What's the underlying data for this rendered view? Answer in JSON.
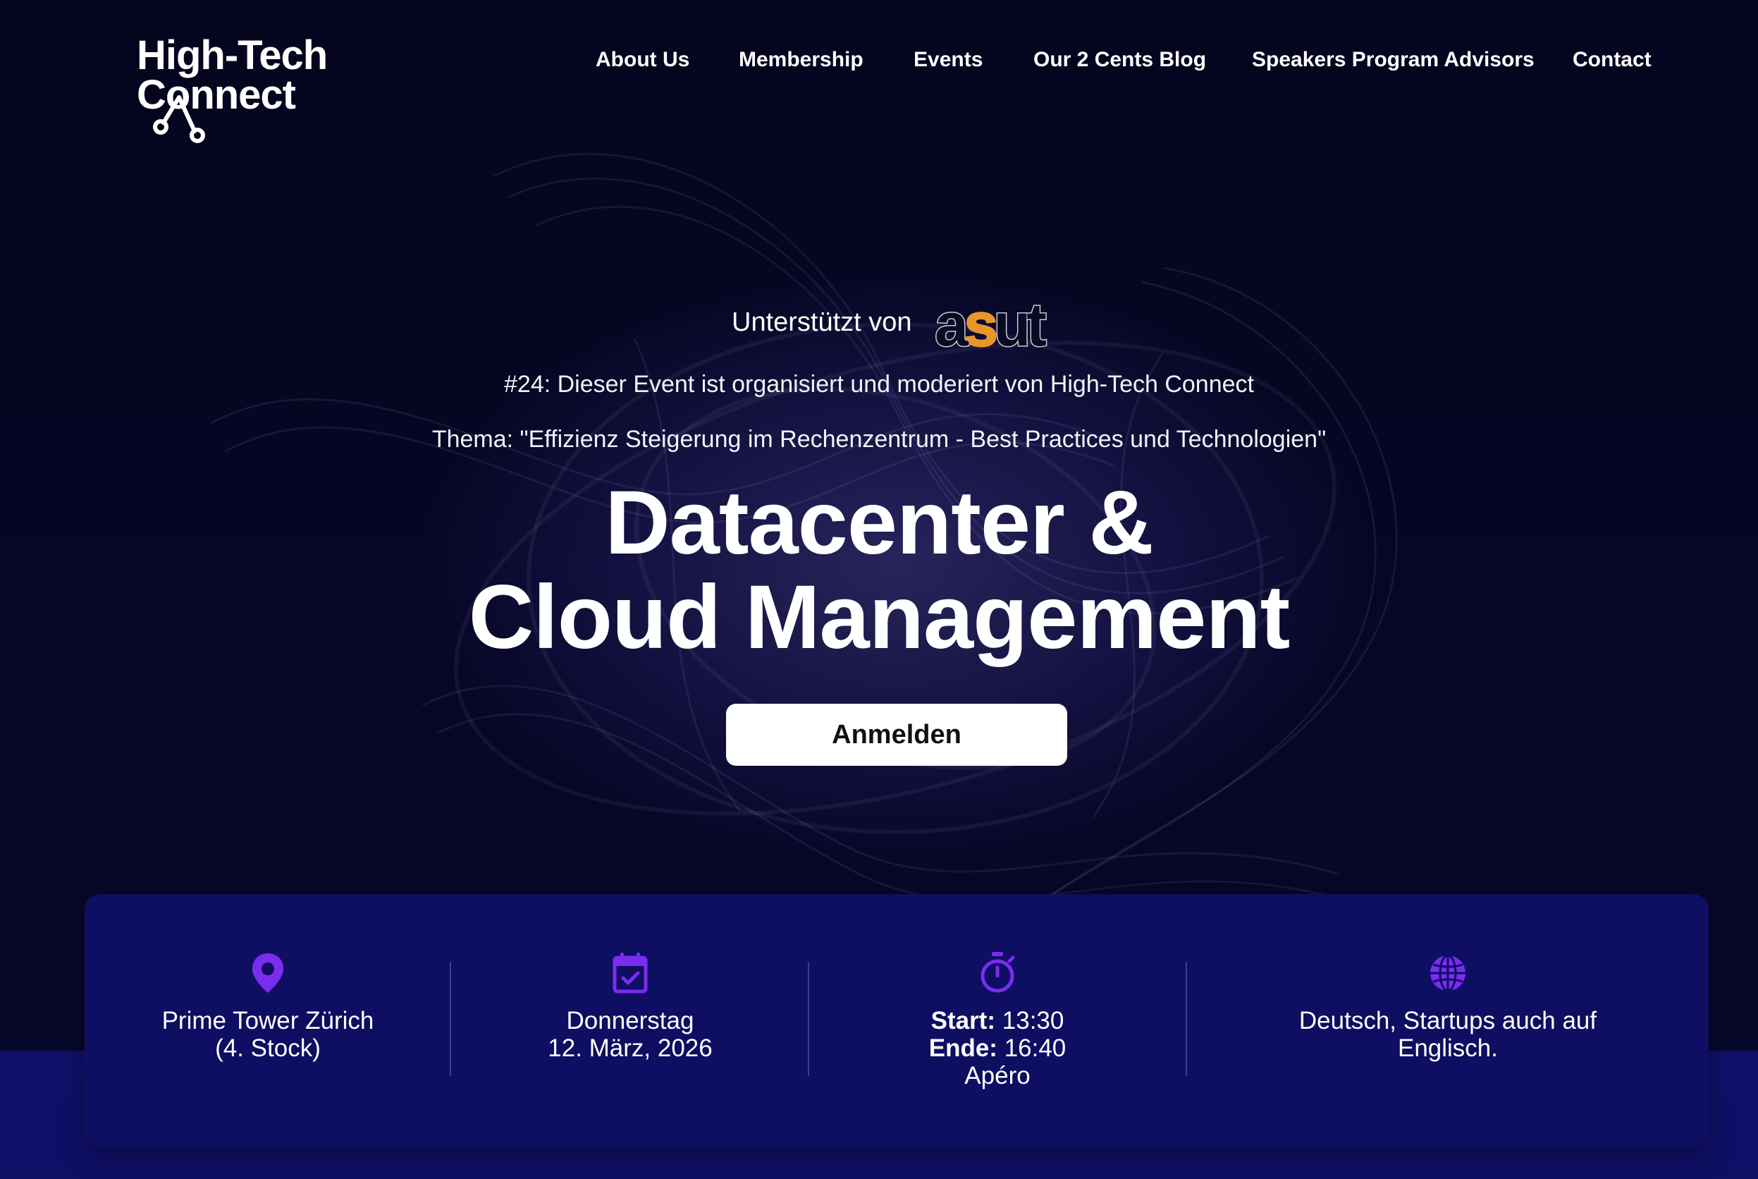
{
  "logo": {
    "line1": "High-Tech",
    "line2": "Connect"
  },
  "nav": [
    {
      "label": "About Us"
    },
    {
      "label": "Membership"
    },
    {
      "label": "Events"
    },
    {
      "label": "Our 2 Cents Blog"
    },
    {
      "label": "Speakers Program Advisors"
    },
    {
      "label": "Contact"
    }
  ],
  "hero": {
    "supported_by": "Unterstützt von",
    "sponsor_logo": "asut",
    "event_line": "#24: Dieser Event ist organisiert und moderiert von High-Tech Connect",
    "theme_line": "Thema: \"Effizienz Steigerung im Rechenzentrum - Best Practices und Technologien\"",
    "title_line1": "Datacenter &",
    "title_line2": "Cloud Management",
    "cta_label": "Anmelden"
  },
  "info": {
    "location": {
      "icon": "location-pin-icon",
      "line1": "Prime Tower Zürich",
      "line2": "(4. Stock)"
    },
    "date": {
      "icon": "calendar-check-icon",
      "line1": "Donnerstag",
      "line2": "12. März, 2026"
    },
    "time": {
      "icon": "stopwatch-icon",
      "start_label": "Start:",
      "start_value": "13:30",
      "end_label": "Ende:",
      "end_value": "16:40",
      "extra": "Apéro"
    },
    "language": {
      "icon": "globe-icon",
      "line1": "Deutsch, Startups auch auf",
      "line2": "Englisch."
    }
  },
  "colors": {
    "background": "#05051f",
    "card": "#0e0e62",
    "accent_icon": "#7a2cf0",
    "asut_orange": "#e7962b"
  }
}
